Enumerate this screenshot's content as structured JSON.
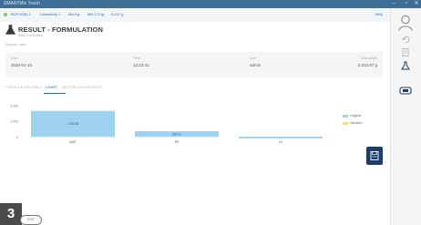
{
  "window": {
    "title": "SMARTMix Touch"
  },
  "toolbar": {
    "items": [
      "BCP 8000-1",
      "Laboratory 1",
      "Mix Kg",
      "Mix 2.3 kg",
      "0.247 g"
    ],
    "right_label": "Help"
  },
  "header": {
    "title": "RESULT - FORMULATION",
    "subtitle": "Base Formulation",
    "breadcrumb": "Supplier Label"
  },
  "info": {
    "fields": [
      {
        "label": "Date",
        "value": "2020-01-15"
      },
      {
        "label": "Time",
        "value": "13:23:41"
      },
      {
        "label": "User",
        "value": "admin"
      },
      {
        "label": "Total weight",
        "value": "2,043.07 g"
      }
    ]
  },
  "tabs": [
    "FORMULATION TABLE",
    "CHART",
    "MIXTURE INGREDIENTS"
  ],
  "chart_data": {
    "type": "bar",
    "categories": [
      "WAT",
      "RS",
      "LV"
    ],
    "series": [
      {
        "name": "Original",
        "values": [
          1662.6,
          364.2,
          16.3
        ],
        "labels": [
          "1,662.58",
          "364.21",
          ""
        ]
      },
      {
        "name": "Variation",
        "values": [
          0,
          0,
          0
        ]
      }
    ],
    "ylim": [
      -100,
      2000
    ],
    "yticks": [
      2000,
      1000,
      0
    ],
    "ytick_labels": [
      "2,000",
      "1,000",
      "0"
    ],
    "colors": {
      "Original": "#9fd2ee",
      "Variation": "#f2e36b"
    }
  },
  "footer": {
    "step": "3",
    "pill_label": "EXIT"
  }
}
